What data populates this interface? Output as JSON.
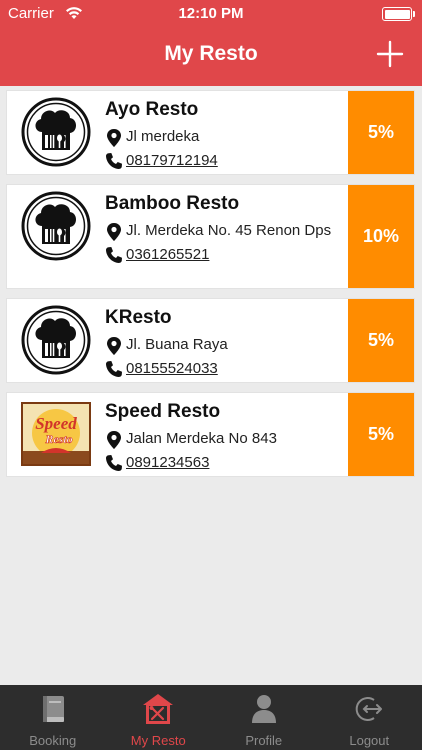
{
  "status": {
    "carrier": "Carrier",
    "time": "12:10 PM"
  },
  "header": {
    "title": "My Resto"
  },
  "restaurants": [
    {
      "name": "Ayo Resto",
      "address": "Jl merdeka",
      "phone": "08179712194",
      "discount": "5%",
      "logo": "chef-hat-logo"
    },
    {
      "name": "Bamboo Resto",
      "address": "Jl. Merdeka No. 45 Renon Dps",
      "phone": "0361265521",
      "discount": "10%",
      "logo": "chef-hat-logo"
    },
    {
      "name": "KResto",
      "address": "Jl. Buana Raya",
      "phone": "08155524033",
      "discount": "5%",
      "logo": "chef-hat-logo"
    },
    {
      "name": "Speed Resto",
      "address": "Jalan Merdeka No 843",
      "phone": "0891234563",
      "discount": "5%",
      "logo": "speed-resto-logo",
      "logo_text": [
        "Speed",
        "Resto"
      ]
    }
  ],
  "tabs": [
    {
      "label": "Booking",
      "icon": "book-icon",
      "active": false
    },
    {
      "label": "My Resto",
      "icon": "restaurant-icon",
      "active": true
    },
    {
      "label": "Profile",
      "icon": "person-icon",
      "active": false
    },
    {
      "label": "Logout",
      "icon": "logout-icon",
      "active": false
    }
  ],
  "colors": {
    "header": "#e0474a",
    "discount": "#ff8c00",
    "tabbar": "#2d2d2d",
    "tab_active": "#e0474a",
    "tab_inactive": "#8c8c8c"
  }
}
